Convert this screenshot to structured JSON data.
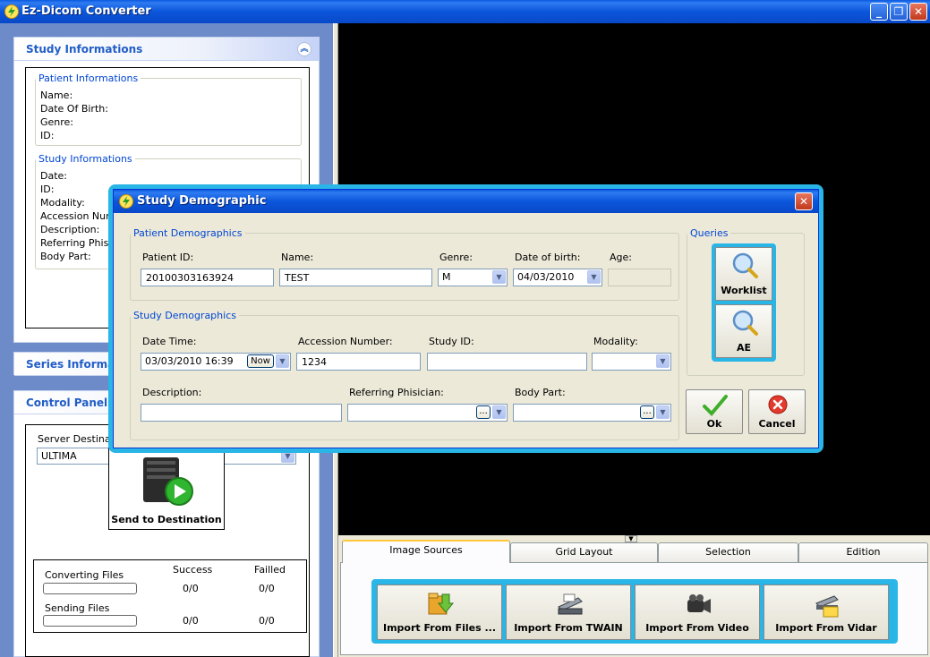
{
  "window": {
    "title": "Ez-Dicom Converter"
  },
  "study_panel": {
    "header": "Study Informations",
    "patient_group": {
      "legend": "Patient Informations",
      "fields": [
        "Name:",
        "Date Of Birth:",
        "Genre:",
        "ID:"
      ]
    },
    "study_group": {
      "legend": "Study Informations",
      "fields": [
        "Date:",
        "ID:",
        "Modality:",
        "Accession Number:",
        "Description:",
        "Referring Phisician:",
        "Body Part:"
      ]
    }
  },
  "series_panel": {
    "header": "Series Informations"
  },
  "control_panel": {
    "header": "Control Panel",
    "server_label": "Server Destination:",
    "server_value": "ULTIMA",
    "send_label": "Send to Destination",
    "col_success": "Success",
    "col_failed": "Failled",
    "converting_label": "Converting Files",
    "converting_success": "0/0",
    "converting_failed": "0/0",
    "sending_label": "Sending Files",
    "sending_success": "0/0",
    "sending_failed": "0/0"
  },
  "tabs": [
    "Image Sources",
    "Grid Layout",
    "Selection",
    "Edition"
  ],
  "import_buttons": [
    "Import From Files ...",
    "Import From TWAIN",
    "Import From Video",
    "Import From Vidar"
  ],
  "dialog": {
    "title": "Study Demographic",
    "patient_legend": "Patient Demographics",
    "patient_id_label": "Patient ID:",
    "patient_id_value": "20100303163924",
    "name_label": "Name:",
    "name_value": "TEST",
    "genre_label": "Genre:",
    "genre_value": "M",
    "dob_label": "Date of birth:",
    "dob_value": "04/03/2010",
    "age_label": "Age:",
    "study_legend": "Study Demographics",
    "datetime_label": "Date Time:",
    "datetime_value": "03/03/2010 16:39",
    "now_label": "Now",
    "accession_label": "Accession Number:",
    "accession_value": "1234",
    "studyid_label": "Study ID:",
    "modality_label": "Modality:",
    "description_label": "Description:",
    "referring_label": "Referring Phisician:",
    "bodypart_label": "Body Part:",
    "browse_label": "...",
    "queries_legend": "Queries",
    "worklist_label": "Worklist",
    "ae_label": "AE",
    "ok_label": "Ok",
    "cancel_label": "Cancel"
  },
  "colors": {
    "highlight": "#29b5e6",
    "xp_blue": "#0a56db",
    "panel_header_text": "#215dc6"
  }
}
